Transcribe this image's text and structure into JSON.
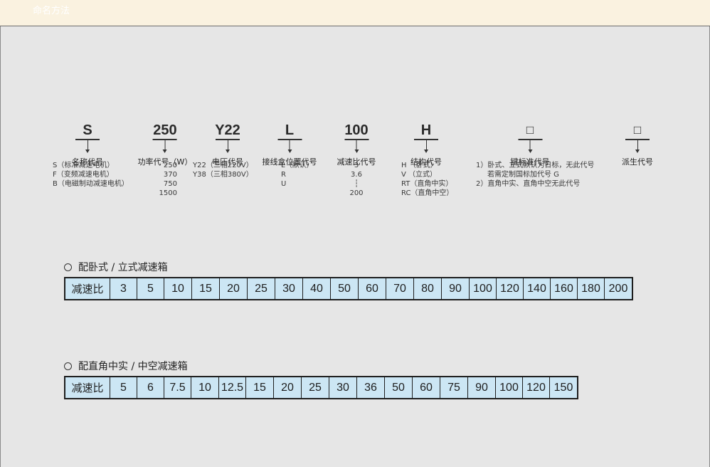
{
  "header": {
    "title": "命名方法"
  },
  "codes": [
    {
      "code": "S",
      "name": "名称代号"
    },
    {
      "code": "250",
      "name": "功率代号（W）"
    },
    {
      "code": "Y22",
      "name": "电压代号"
    },
    {
      "code": "L",
      "name": "接线盒位置代号"
    },
    {
      "code": "100",
      "name": "减速比代号"
    },
    {
      "code": "H",
      "name": "结构代号"
    },
    {
      "code": "□",
      "name": "键标准代号"
    },
    {
      "code": "□",
      "name": "派生代号"
    }
  ],
  "descriptions": {
    "name": [
      "S（标准减速电机）",
      "F（变频减速电机）",
      "B（电磁制动减速电机）"
    ],
    "power": [
      "250",
      "370",
      "750",
      "1500"
    ],
    "voltage": [
      "Y22（三相220V）",
      "Y38（三相380V）"
    ],
    "junction": [
      "L（默认）",
      "R",
      "U"
    ],
    "ratio": [
      "3",
      "3.6",
      "┆",
      "200"
    ],
    "structure": [
      "H （卧式）",
      "V （立式）",
      "RT（直角中实）",
      "RC（直角中空）"
    ],
    "key_standard": [
      "1）卧式、立式默认为日标，无此代号",
      "若需定制国标加代号 G",
      "2）直角中实、直角中空无此代号"
    ]
  },
  "tables": [
    {
      "title": "配卧式 / 立式减速箱",
      "header": "减速比",
      "values": [
        "3",
        "5",
        "10",
        "15",
        "20",
        "25",
        "30",
        "40",
        "50",
        "60",
        "70",
        "80",
        "90",
        "100",
        "120",
        "140",
        "160",
        "180",
        "200"
      ]
    },
    {
      "title": "配直角中实 / 中空减速箱",
      "header": "减速比",
      "values": [
        "5",
        "6",
        "7.5",
        "10",
        "12.5",
        "15",
        "20",
        "25",
        "30",
        "36",
        "50",
        "60",
        "75",
        "90",
        "100",
        "120",
        "150"
      ]
    }
  ]
}
